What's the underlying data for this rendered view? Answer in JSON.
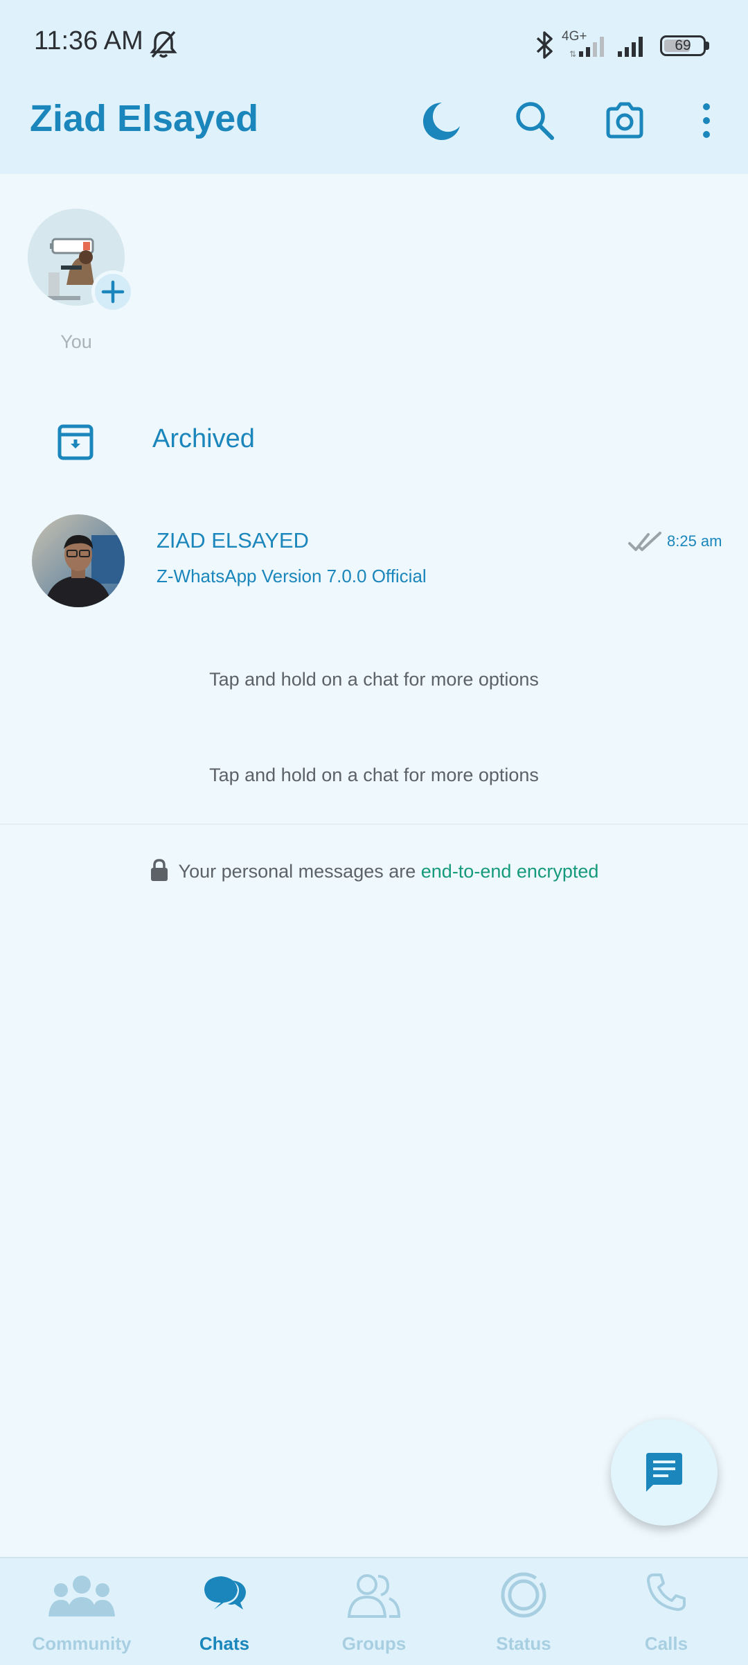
{
  "status_bar": {
    "time": "11:36 AM",
    "network": "4G+",
    "battery": "69",
    "battery_level": 0.69
  },
  "header": {
    "title": "Ziad Elsayed",
    "icons": [
      "moon-icon",
      "search-icon",
      "camera-icon",
      "more-vert-icon"
    ]
  },
  "status": {
    "my_label": "You"
  },
  "archived": {
    "label": "Archived"
  },
  "chats": [
    {
      "name": "ZIAD ELSAYED",
      "preview": "Z-WhatsApp Version 7.0.0 Official",
      "time": "8:25 am"
    }
  ],
  "hints": [
    "Tap and hold on a chat for more options",
    "Tap and hold on a chat for more options"
  ],
  "encryption": {
    "text": "Your personal messages are ",
    "link": "end-to-end encrypted"
  },
  "bottom_nav": [
    {
      "label": "Community",
      "icon": "community-icon",
      "active": false
    },
    {
      "label": "Chats",
      "icon": "chats-icon",
      "active": true
    },
    {
      "label": "Groups",
      "icon": "groups-icon",
      "active": false
    },
    {
      "label": "Status",
      "icon": "status-icon",
      "active": false
    },
    {
      "label": "Calls",
      "icon": "calls-icon",
      "active": false
    }
  ],
  "colors": {
    "accent": "#1b86bb",
    "background": "#eef8fd",
    "header_bg": "#dff2fb",
    "link_green": "#159a7b",
    "inactive_nav": "#a8cfe1"
  }
}
